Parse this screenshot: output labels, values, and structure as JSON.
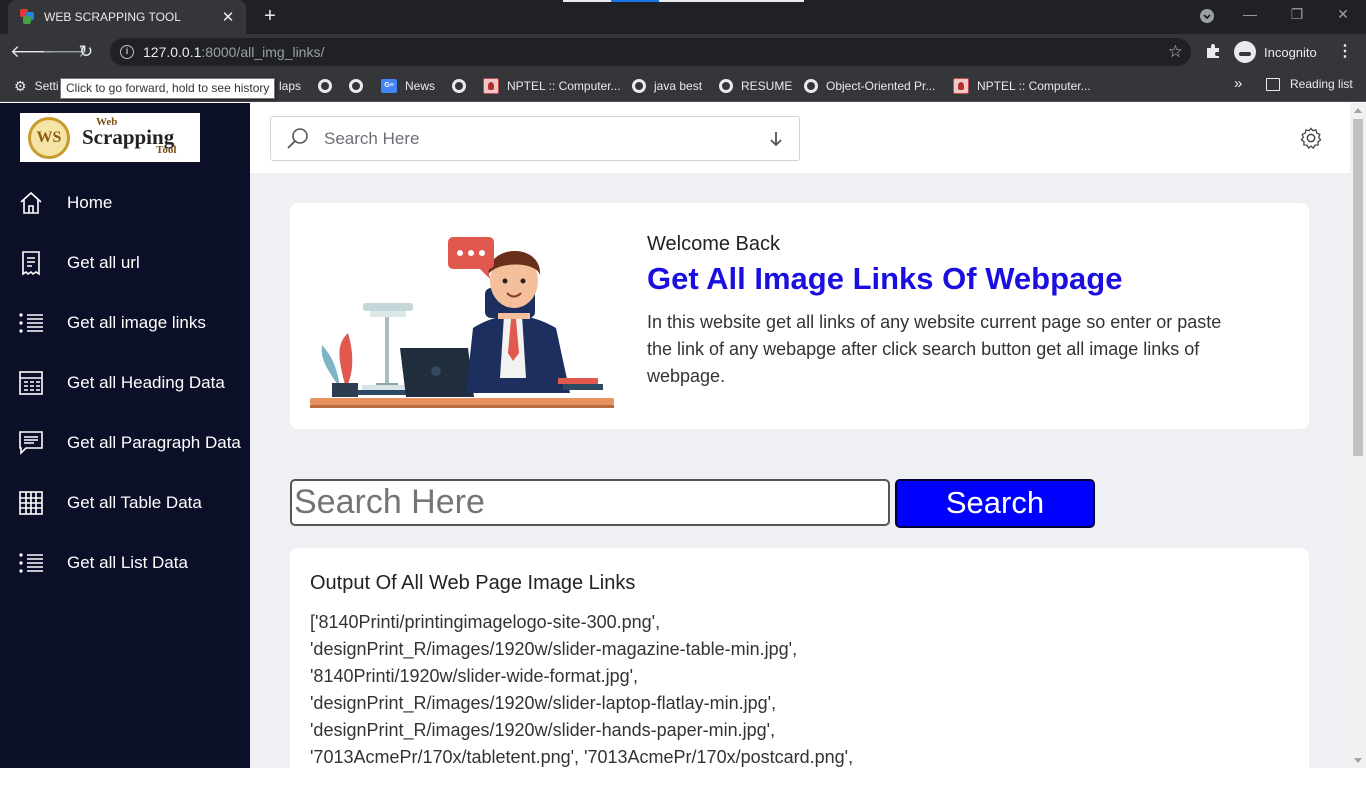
{
  "browser": {
    "tab_title": "WEB SCRAPPING TOOL",
    "url_host": "127.0.0.1",
    "url_path": ":8000/all_img_links/",
    "profile_label": "Incognito",
    "tooltip": "Click to go forward, hold to see history",
    "bookmarks": [
      "Setti",
      "laps",
      "News",
      "NPTEL :: Computer...",
      "java best",
      "RESUME",
      "Object-Oriented Pr...",
      "NPTEL :: Computer..."
    ],
    "reading_list": "Reading list"
  },
  "logo": {
    "top": "Web",
    "main": "Scrapping",
    "bottom": "Tool",
    "badge": "WS"
  },
  "sidebar": {
    "items": [
      {
        "label": "Home",
        "icon": "home-icon"
      },
      {
        "label": "Get all url",
        "icon": "document-icon"
      },
      {
        "label": "Get all image links",
        "icon": "list-icon"
      },
      {
        "label": "Get all Heading Data",
        "icon": "heading-grid-icon"
      },
      {
        "label": "Get all Paragraph Data",
        "icon": "paragraph-icon"
      },
      {
        "label": "Get all Table Data",
        "icon": "table-icon"
      },
      {
        "label": "Get all List Data",
        "icon": "list-icon"
      }
    ]
  },
  "topbar": {
    "search_placeholder": "Search Here"
  },
  "welcome": {
    "greeting": "Welcome Back",
    "title": "Get All Image Links Of Webpage",
    "description": "In this website get all links of any website current page so enter or paste the link of any webapge after click search button get all image links of webpage."
  },
  "search_form": {
    "placeholder": "Search Here",
    "button": "Search"
  },
  "output": {
    "title": "Output Of All Web Page Image Links",
    "lines": [
      "['8140Printi/printingimagelogo-site-300.png',",
      "'designPrint_R/images/1920w/slider-magazine-table-min.jpg',",
      "'8140Printi/1920w/slider-wide-format.jpg',",
      "'designPrint_R/images/1920w/slider-laptop-flatlay-min.jpg',",
      "'designPrint_R/images/1920w/slider-hands-paper-min.jpg',",
      "'7013AcmePr/170x/tabletent.png', '7013AcmePr/170x/postcard.png',"
    ]
  },
  "colors": {
    "sidebar_bg": "#0b1028",
    "accent_title": "#1a0fe0",
    "search_button": "#0000ff"
  }
}
